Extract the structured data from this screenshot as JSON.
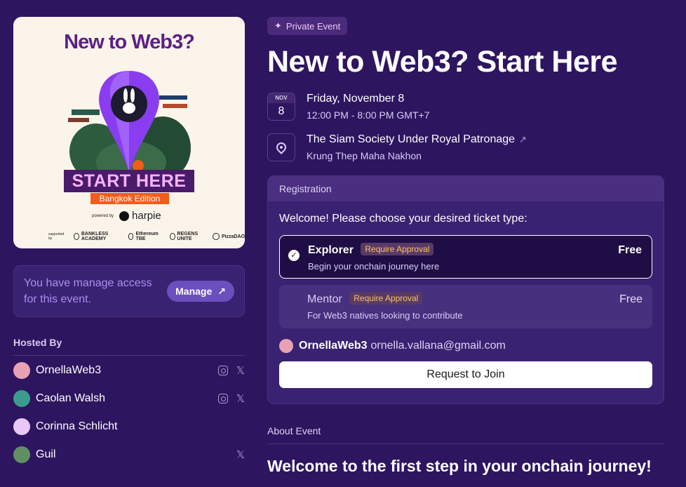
{
  "poster": {
    "title": "New to Web3?",
    "start_here": "START HERE",
    "edition": "Bangkok Edition",
    "powered_by": "powered by",
    "brand": "harpie",
    "supported_by": "supported by",
    "sponsors": [
      "BANKLESS ACADEMY",
      "Ethereum TBE",
      "REGENS UNITE",
      "PizzaDAO"
    ]
  },
  "manage": {
    "text": "You have manage access for this event.",
    "button": "Manage"
  },
  "hosted": {
    "label": "Hosted By",
    "hosts": [
      {
        "name": "OrnellaWeb3",
        "avatar_color": "#e9a2b4",
        "socials": [
          "instagram-icon",
          "x-icon"
        ]
      },
      {
        "name": "Caolan Walsh",
        "avatar_color": "#3b9c8d",
        "socials": [
          "instagram-icon",
          "x-icon"
        ]
      },
      {
        "name": "Corinna Schlicht",
        "avatar_color": "#e9c8f5",
        "socials": []
      },
      {
        "name": "Guil",
        "avatar_color": "#5f8f63",
        "socials": [
          "x-icon"
        ]
      }
    ]
  },
  "event": {
    "badge": "Private Event",
    "title": "New to Web3? Start Here",
    "date": {
      "month": "NOV",
      "day": "8",
      "main": "Friday, November 8",
      "sub": "12:00 PM - 8:00 PM GMT+7"
    },
    "location": {
      "main": "The Siam Society Under Royal Patronage",
      "sub": "Krung Thep Maha Nakhon"
    }
  },
  "registration": {
    "header": "Registration",
    "welcome": "Welcome! Please choose your desired ticket type:",
    "tickets": [
      {
        "name": "Explorer",
        "approval": "Require Approval",
        "price": "Free",
        "desc": "Begin your onchain journey here",
        "selected": true
      },
      {
        "name": "Mentor",
        "approval": "Require Approval",
        "price": "Free",
        "desc": "For Web3 natives looking to contribute",
        "selected": false
      }
    ],
    "user": {
      "name": "OrnellaWeb3",
      "email": "ornella.vallana@gmail.com"
    },
    "join_button": "Request to Join"
  },
  "about": {
    "label": "About Event",
    "heading": "Welcome to the first step in your onchain journey!"
  }
}
